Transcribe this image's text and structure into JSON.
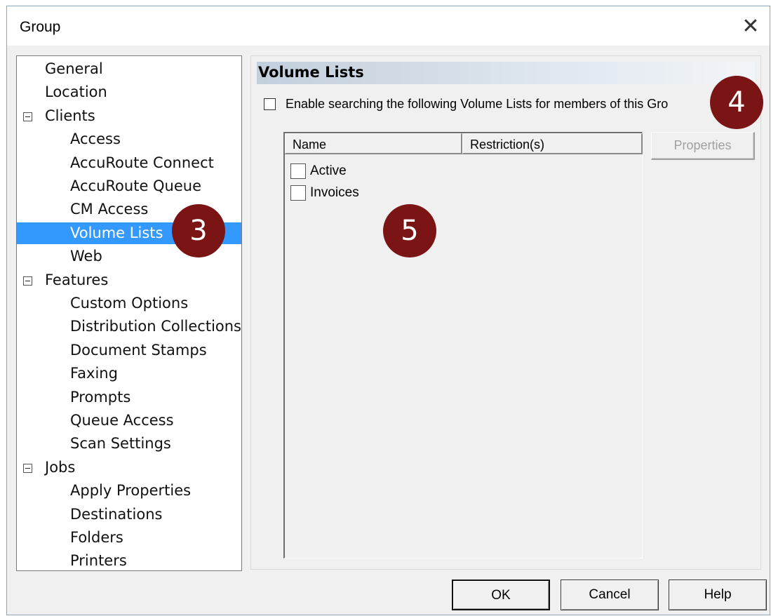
{
  "window": {
    "title": "Group",
    "close_glyph": "✕"
  },
  "tree": {
    "items": [
      {
        "label": "General",
        "level": 0,
        "expander": false
      },
      {
        "label": "Location",
        "level": 0,
        "expander": false
      },
      {
        "label": "Clients",
        "level": 0,
        "expander": true
      },
      {
        "label": "Access",
        "level": 1,
        "expander": false
      },
      {
        "label": "AccuRoute Connect",
        "level": 1,
        "expander": false
      },
      {
        "label": "AccuRoute Queue",
        "level": 1,
        "expander": false
      },
      {
        "label": "CM Access",
        "level": 1,
        "expander": false
      },
      {
        "label": "Volume Lists",
        "level": 1,
        "expander": false,
        "selected": true
      },
      {
        "label": "Web",
        "level": 1,
        "expander": false
      },
      {
        "label": "Features",
        "level": 0,
        "expander": true
      },
      {
        "label": "Custom Options",
        "level": 1,
        "expander": false
      },
      {
        "label": "Distribution Collections",
        "level": 1,
        "expander": false
      },
      {
        "label": "Document Stamps",
        "level": 1,
        "expander": false
      },
      {
        "label": "Faxing",
        "level": 1,
        "expander": false
      },
      {
        "label": "Prompts",
        "level": 1,
        "expander": false
      },
      {
        "label": "Queue Access",
        "level": 1,
        "expander": false
      },
      {
        "label": "Scan Settings",
        "level": 1,
        "expander": false
      },
      {
        "label": "Jobs",
        "level": 0,
        "expander": true
      },
      {
        "label": "Apply Properties",
        "level": 1,
        "expander": false
      },
      {
        "label": "Destinations",
        "level": 1,
        "expander": false
      },
      {
        "label": "Folders",
        "level": 1,
        "expander": false
      },
      {
        "label": "Printers",
        "level": 1,
        "expander": false
      }
    ]
  },
  "panel": {
    "title": "Volume Lists",
    "enable_label": "Enable searching the following Volume Lists for members of this Gro",
    "enable_checked": false,
    "columns": [
      "Name",
      "Restriction(s)"
    ],
    "rows": [
      {
        "name": "Active",
        "checked": false
      },
      {
        "name": "Invoices",
        "checked": false
      }
    ],
    "properties_label": "Properties",
    "properties_enabled": false
  },
  "buttons": {
    "ok": "OK",
    "cancel": "Cancel",
    "help": "Help"
  },
  "markers": [
    "3",
    "4",
    "5"
  ],
  "colors": {
    "selection": "#3399ff",
    "marker": "#7b1414"
  }
}
